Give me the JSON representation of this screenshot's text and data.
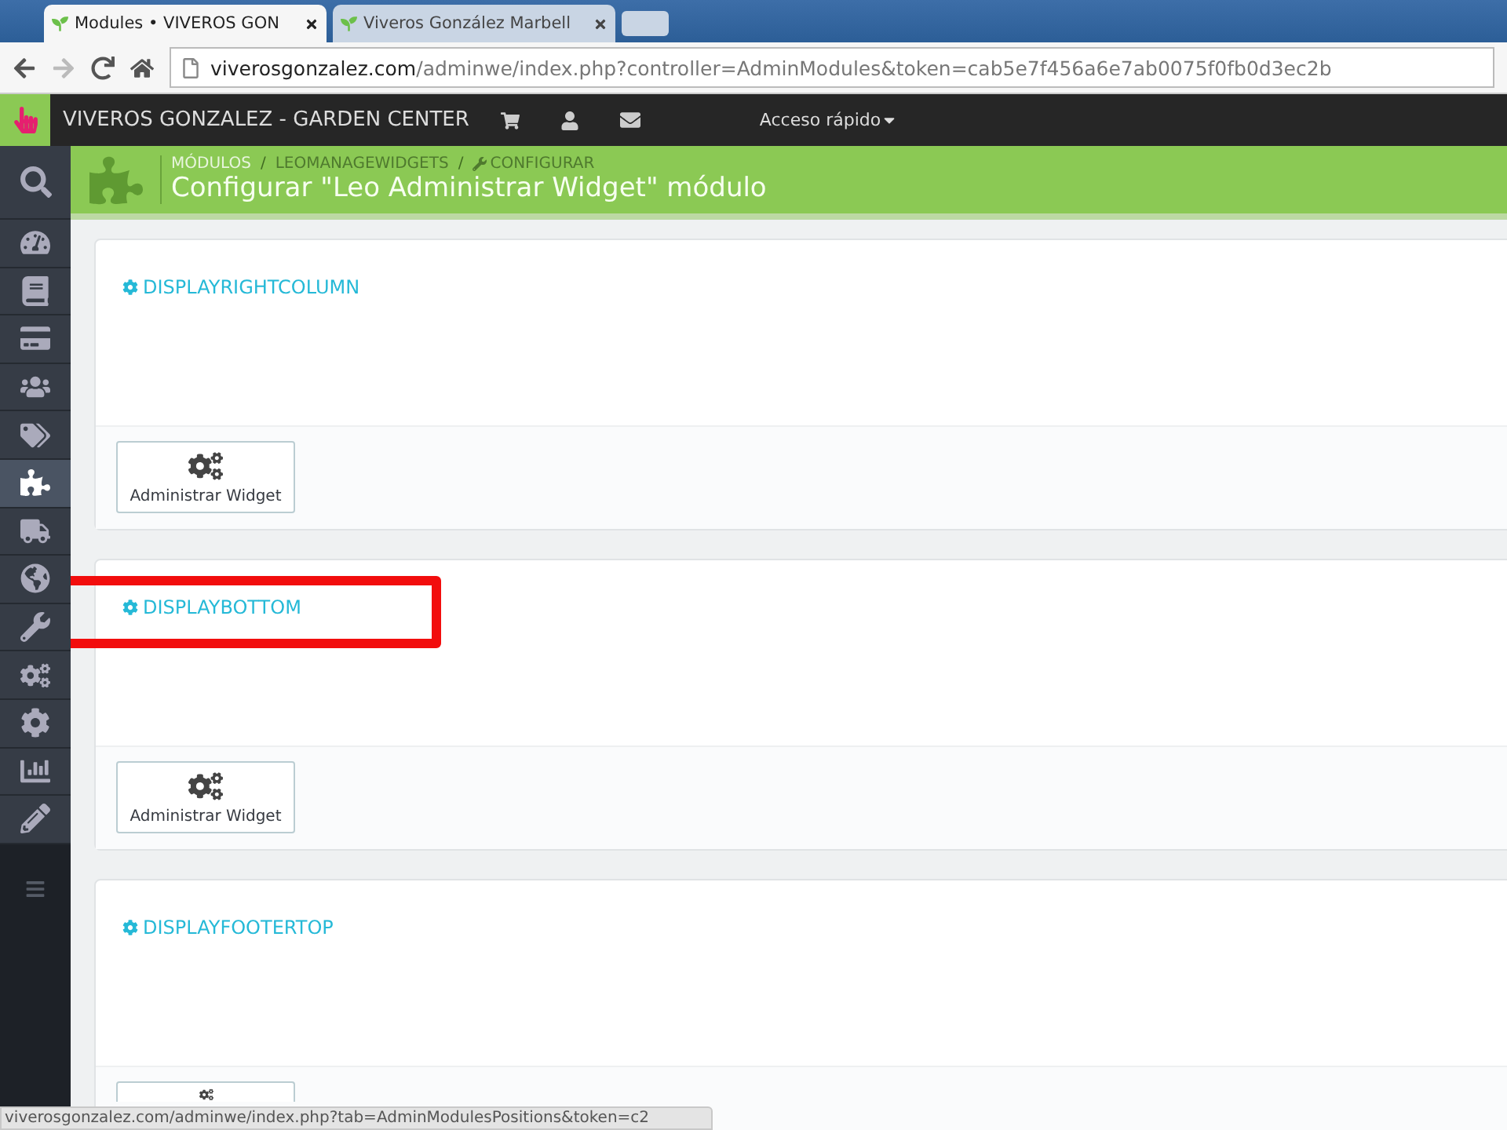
{
  "browser": {
    "tabs": [
      {
        "title": "Modules • VIVEROS GON",
        "selected": true
      },
      {
        "title": "Viveros González Marbell",
        "selected": false
      }
    ],
    "address": {
      "host": "viverosgonzalez.com",
      "path": "/adminwe/index.php?controller=AdminModules&token=cab5e7f456a6e7ab0075f0fb0d3ec2b"
    }
  },
  "topbar": {
    "shop_name": "VIVEROS GONZALEZ - GARDEN CENTER",
    "quick_access": "Acceso rápido"
  },
  "sidebar": {
    "items": [
      {
        "selected": false
      },
      {
        "selected": false
      },
      {
        "selected": false
      },
      {
        "selected": false
      },
      {
        "selected": false
      },
      {
        "selected": true
      },
      {
        "selected": false
      },
      {
        "selected": false
      },
      {
        "selected": false
      },
      {
        "selected": false
      },
      {
        "selected": false
      },
      {
        "selected": false
      },
      {
        "selected": false
      }
    ]
  },
  "header": {
    "separator": "/",
    "breadcrumbs": [
      "MÓDULOS",
      "LEOMANAGEWIDGETS",
      "CONFIGURAR"
    ],
    "title": "Configurar \"Leo Administrar Widget\" módulo"
  },
  "panels": [
    {
      "hook": "DISPLAYRIGHTCOLUMN",
      "button": "Administrar Widget",
      "highlighted": false
    },
    {
      "hook": "DISPLAYBOTTOM",
      "button": "Administrar Widget",
      "highlighted": true
    },
    {
      "hook": "DISPLAYFOOTERTOP",
      "highlighted": false
    }
  ],
  "status_bar": "viverosgonzalez.com/adminwe/index.php?tab=AdminModulesPositions&token=c2"
}
